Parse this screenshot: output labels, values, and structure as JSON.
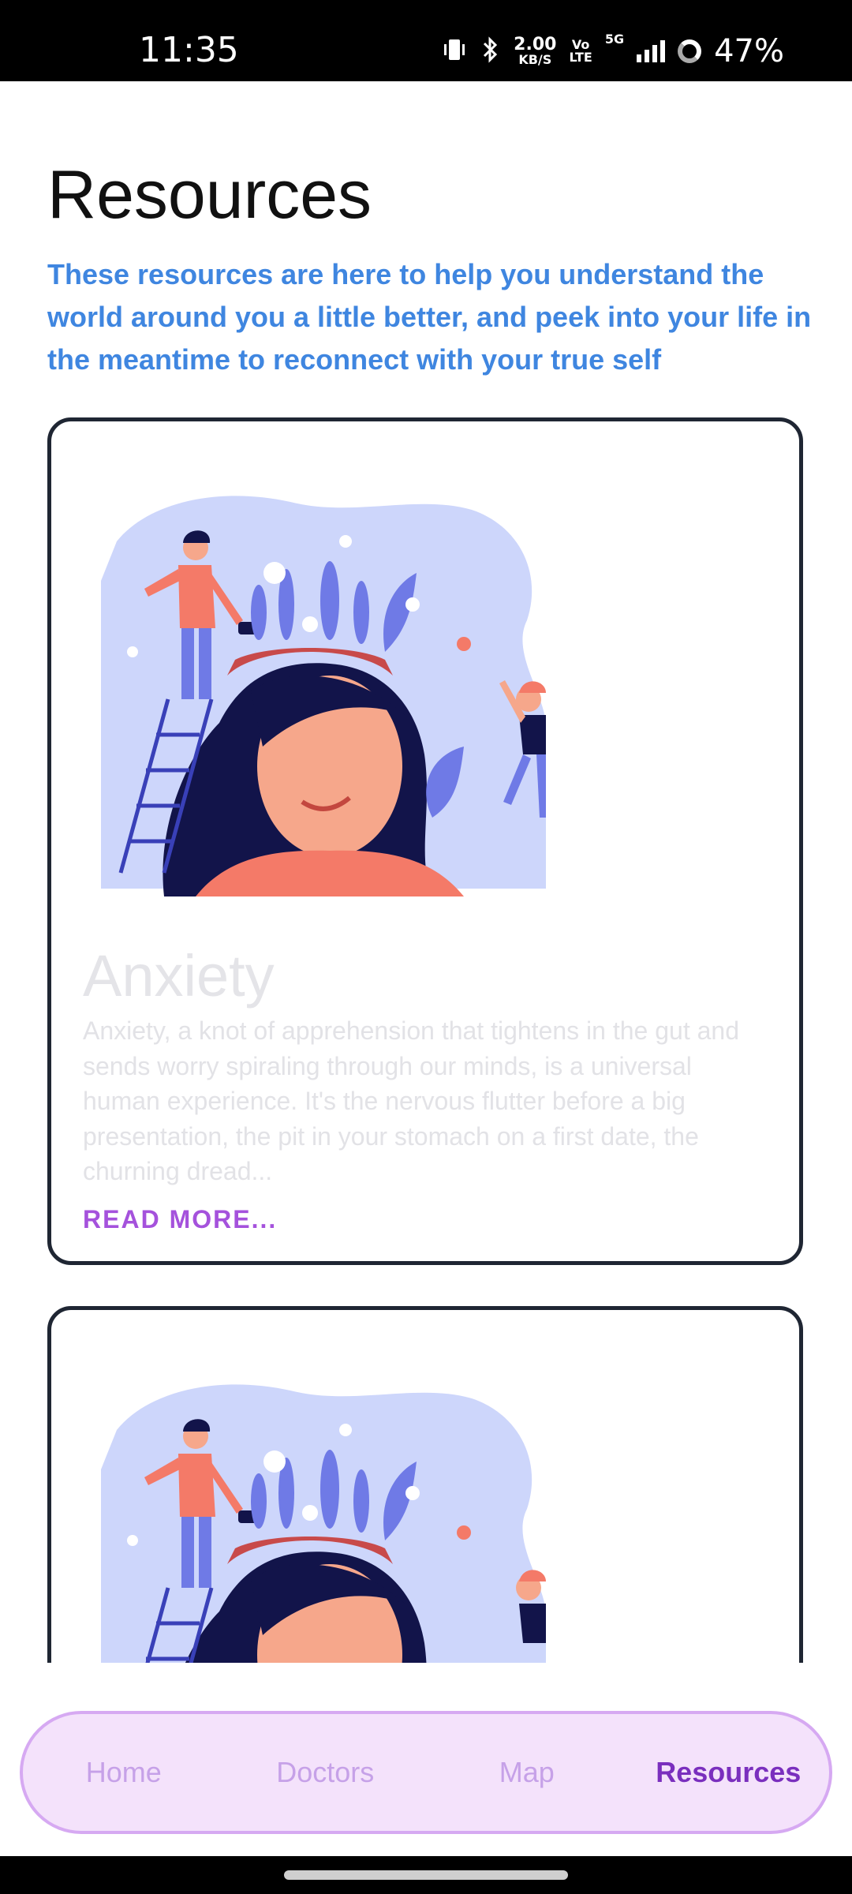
{
  "status_bar": {
    "time": "11:35",
    "net_speed_value": "2.00",
    "net_speed_unit": "KB/S",
    "volte_top": "Vo",
    "volte_bottom": "LTE",
    "network": "5G",
    "battery": "47%",
    "icons": [
      "vibrate-icon",
      "bluetooth-icon",
      "signal-icon",
      "battery-ring-icon"
    ]
  },
  "page": {
    "title": "Resources",
    "intro": "These resources are here to help you understand the world around you a little better, and peek into your life in the meantime to reconnect with your true self"
  },
  "cards": [
    {
      "title": "Anxiety",
      "description": "Anxiety, a knot of apprehension that tightens in the gut and sends worry spiraling through our minds, is a universal human experience. It's the nervous flutter before a big presentation, the pit in your stomach on a first date, the churning dread...",
      "read_more": "READ MORE..."
    }
  ],
  "nav": {
    "items": [
      {
        "label": "Home"
      },
      {
        "label": "Doctors"
      },
      {
        "label": "Map"
      },
      {
        "label": "Resources"
      }
    ],
    "active": "Resources"
  },
  "colors": {
    "accent_blue": "#3f86e0",
    "read_more": "#a552dc",
    "nav_active": "#7a2fbe",
    "nav_inactive": "#c6a1e8",
    "nav_background": "#f4e2fb",
    "card_border": "#1f2633"
  }
}
